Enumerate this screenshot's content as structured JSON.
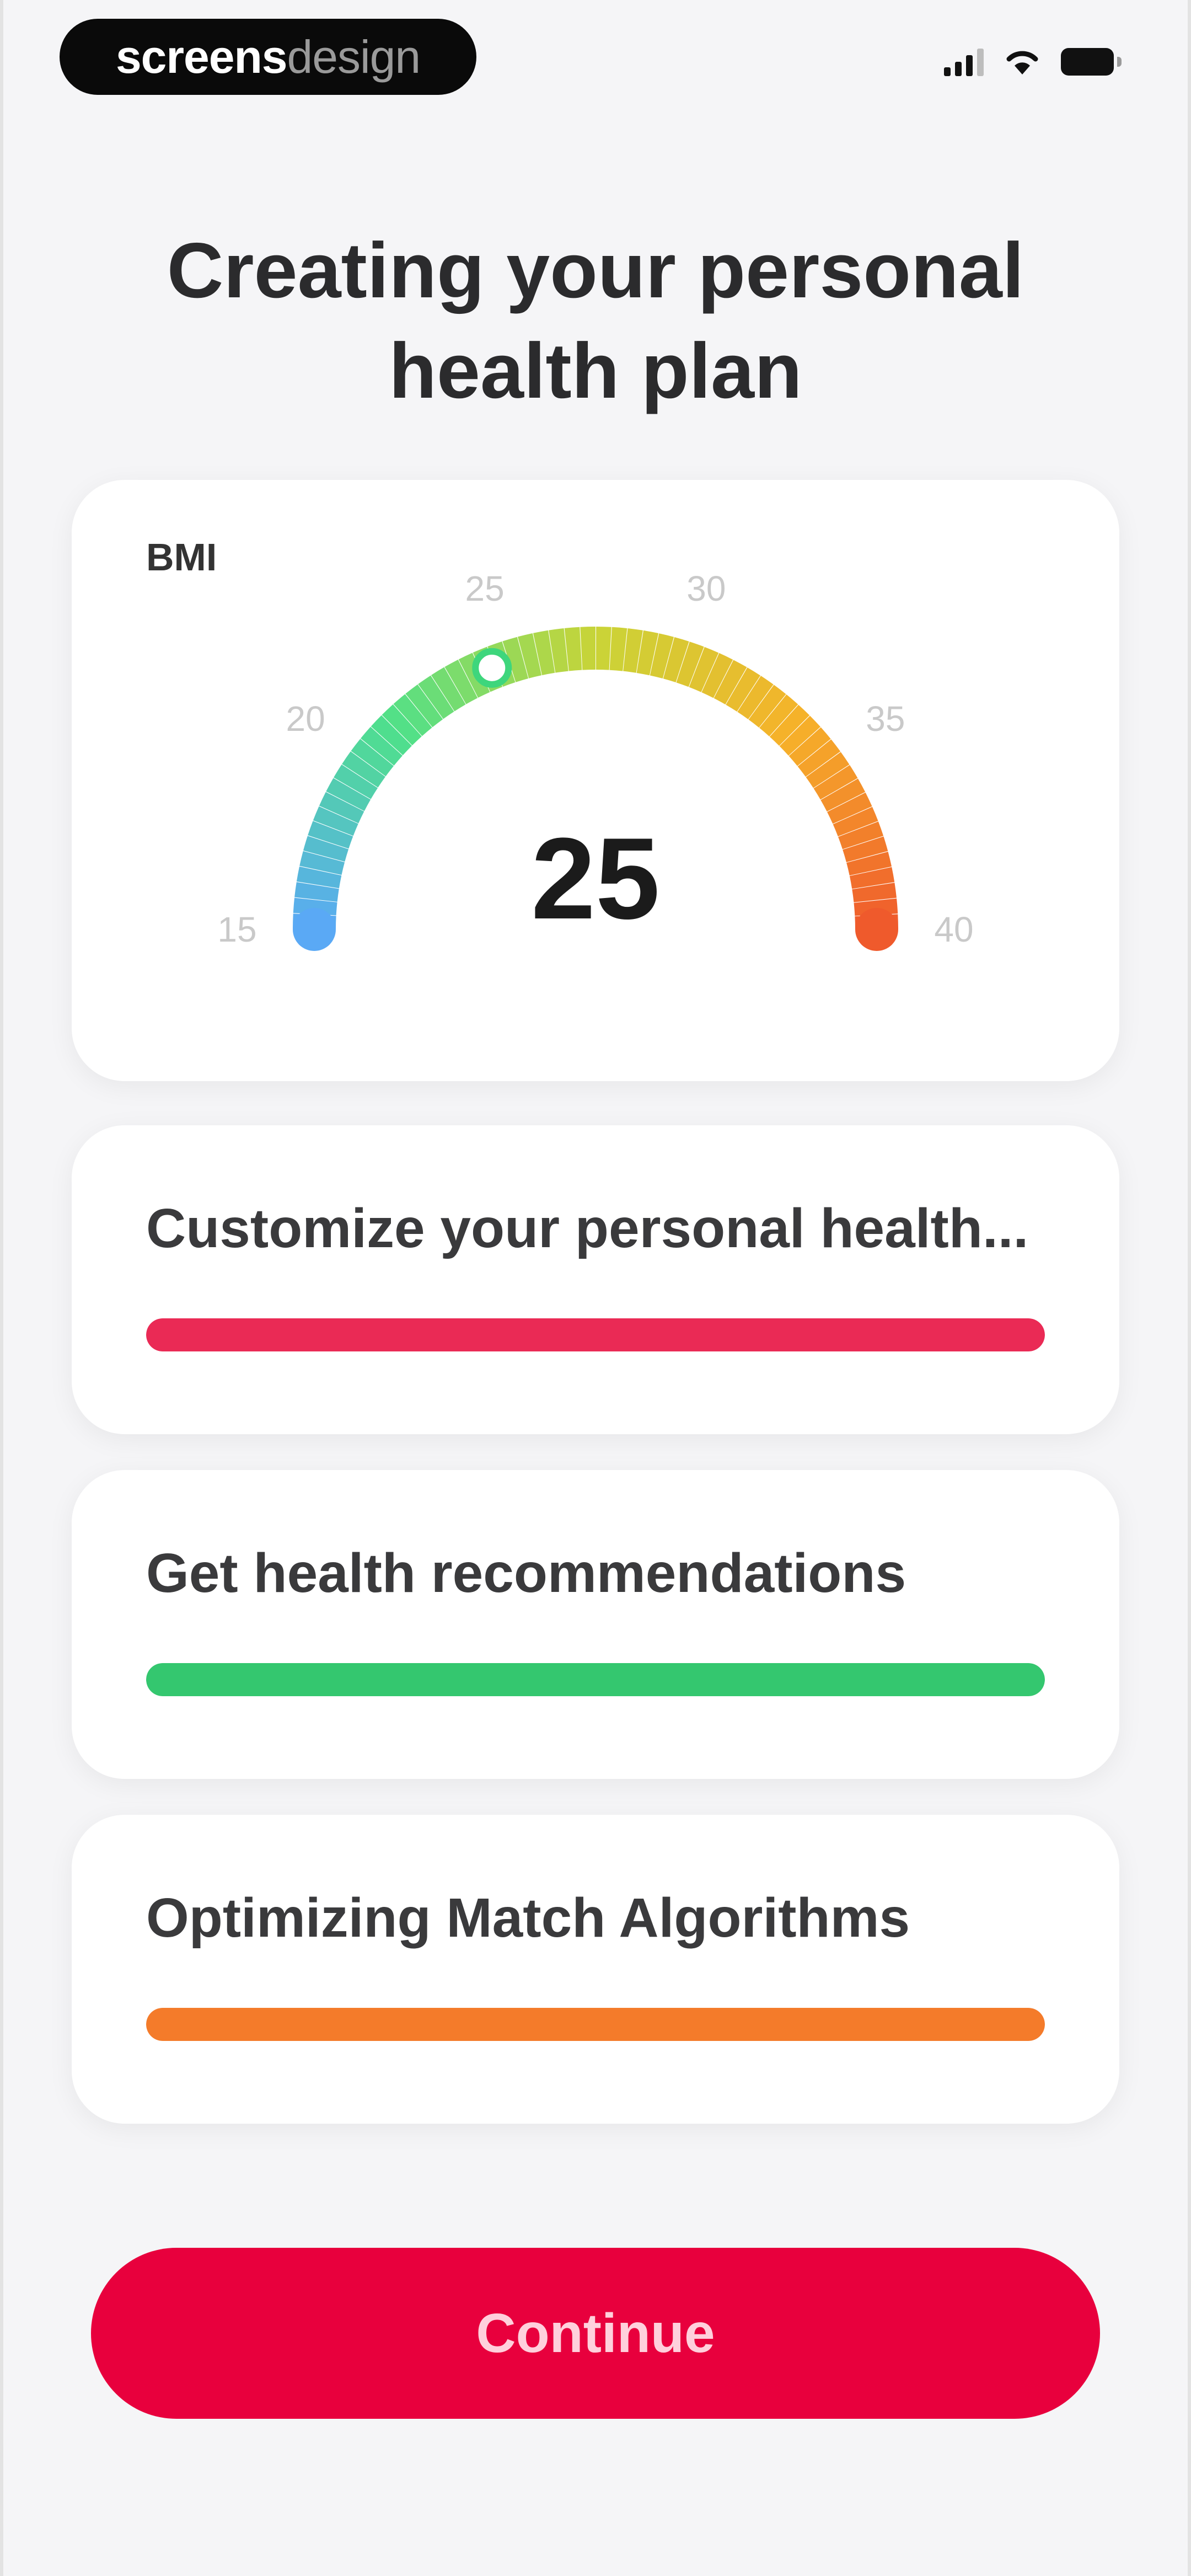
{
  "status_bar": {
    "brand_bold": "screens",
    "brand_light": "design",
    "icons": [
      "signal-icon",
      "wifi-icon",
      "battery-icon"
    ]
  },
  "page": {
    "title": "Creating your personal health plan"
  },
  "bmi": {
    "label": "BMI",
    "value": "25",
    "min": 15,
    "max": 40,
    "current": 24.5,
    "ticks": [
      "15",
      "20",
      "25",
      "30",
      "35",
      "40"
    ],
    "gradient_colors": [
      "#5aa9f5",
      "#4fe08a",
      "#c9d437",
      "#f6b12a",
      "#ef5a2c"
    ]
  },
  "tasks": [
    {
      "label": "Customize your personal health...",
      "progress": 1.0,
      "color": "#ea2a55"
    },
    {
      "label": "Get health recommendations",
      "progress": 1.0,
      "color": "#34c76f"
    },
    {
      "label": "Optimizing Match Algorithms",
      "progress": 1.0,
      "color": "#f47b2a"
    }
  ],
  "actions": {
    "continue_label": "Continue",
    "continue_color": "#e8003d"
  }
}
